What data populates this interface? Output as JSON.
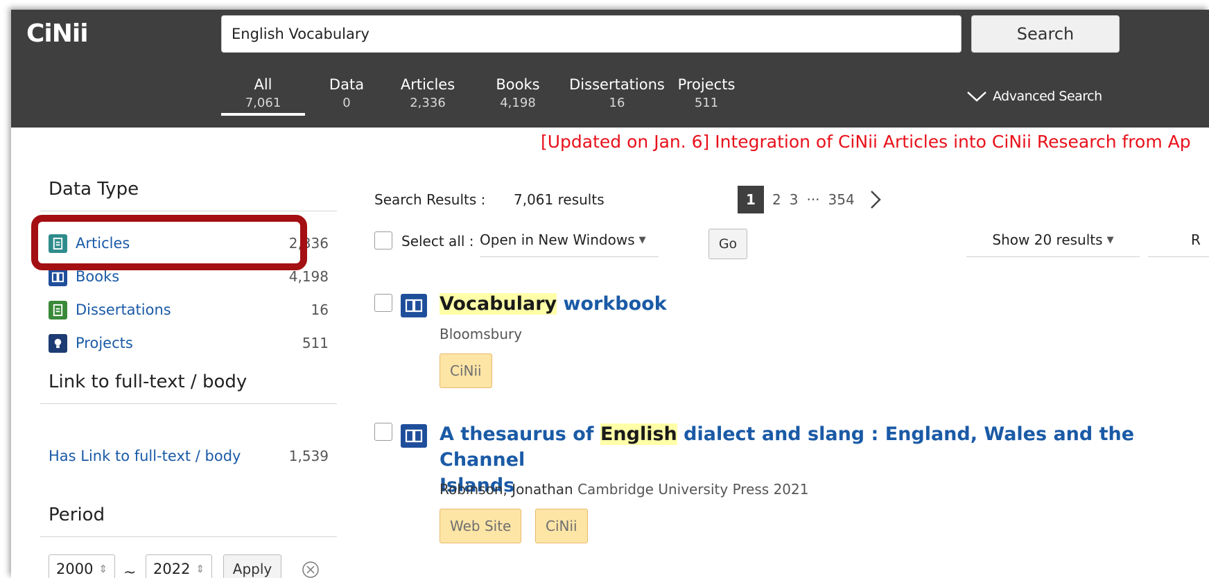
{
  "header": {
    "logo": "CiNii",
    "search_value": "English Vocabulary",
    "search_button": "Search",
    "advanced_search": "Advanced Search",
    "tabs": [
      {
        "label": "All",
        "count": "7,061"
      },
      {
        "label": "Data",
        "count": "0"
      },
      {
        "label": "Articles",
        "count": "2,336"
      },
      {
        "label": "Books",
        "count": "4,198"
      },
      {
        "label": "Dissertations",
        "count": "16"
      },
      {
        "label": "Projects",
        "count": "511"
      }
    ]
  },
  "notice": "[Updated on Jan. 6] Integration of CiNii Articles into CiNii Research from Ap",
  "sidebar": {
    "data_type_heading": "Data Type",
    "facets": [
      {
        "label": "Articles",
        "count": "2,336",
        "icon": "article-icon",
        "color": "#2f8c8c"
      },
      {
        "label": "Books",
        "count": "4,198",
        "icon": "book-icon",
        "color": "#1f4e9b"
      },
      {
        "label": "Dissertations",
        "count": "16",
        "icon": "dissertation-icon",
        "color": "#3a8a3a"
      },
      {
        "label": "Projects",
        "count": "511",
        "icon": "lightbulb-icon",
        "color": "#1d3c73"
      }
    ],
    "link_heading": "Link to full-text / body",
    "link_facet": {
      "label": "Has Link to full-text / body",
      "count": "1,539"
    },
    "period_heading": "Period",
    "period_from": "2000",
    "period_to": "2022",
    "apply": "Apply"
  },
  "results": {
    "label": "Search Results :",
    "count": "7,061 results",
    "pager": {
      "current": "1",
      "pages": [
        "2",
        "3"
      ],
      "ellipsis": "···",
      "last": "354"
    },
    "select_all": "Select all :",
    "open_option": "Open in New Windows",
    "go": "Go",
    "show_option": "Show 20 results",
    "sort_option_partial": "R",
    "items": [
      {
        "title_mark": "Vocabulary",
        "title_rest": "workbook",
        "meta": "Bloomsbury",
        "tags": [
          "CiNii"
        ]
      },
      {
        "title_pre": "A thesaurus of",
        "title_mark": "English",
        "title_post": "dialect and slang : England, Wales and the Channel",
        "title_line2": "Islands",
        "author": "Robinson, Jonathan",
        "meta": "Cambridge University Press 2021",
        "tags": [
          "Web Site",
          "CiNii"
        ]
      }
    ]
  }
}
